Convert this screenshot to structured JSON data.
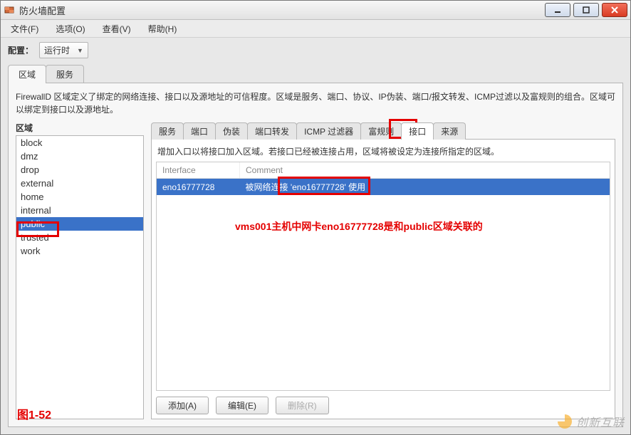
{
  "window": {
    "title": "防火墙配置"
  },
  "menubar": {
    "file": "文件(F)",
    "options": "选项(O)",
    "view": "查看(V)",
    "help": "帮助(H)"
  },
  "config": {
    "label": "配置：",
    "value": "运行时"
  },
  "outer_tabs": {
    "zones": "区域",
    "services": "服务"
  },
  "zone_desc": "FirewallD 区域定义了绑定的网络连接、接口以及源地址的可信程度。区域是服务、端口、协议、IP伪装、端口/报文转发、ICMP过滤以及富规则的组合。区域可以绑定到接口以及源地址。",
  "zone_label": "区域",
  "zones": [
    "block",
    "dmz",
    "drop",
    "external",
    "home",
    "internal",
    "public",
    "trusted",
    "work"
  ],
  "zone_selected": "public",
  "inner_tabs": {
    "services": "服务",
    "ports": "端口",
    "masquerade": "伪装",
    "port_forward": "端口转发",
    "icmp_filter": "ICMP 过滤器",
    "rich_rules": "富规则",
    "interfaces": "接口",
    "sources": "来源"
  },
  "iface_desc": "增加入口以将接口加入区域。若接口已经被连接占用，区域将被设定为连接所指定的区域。",
  "iface_table": {
    "headers": {
      "interface": "Interface",
      "comment": "Comment"
    },
    "rows": [
      {
        "interface": "eno16777728",
        "comment": "被网络连接 'eno16777728' 使用"
      }
    ]
  },
  "buttons": {
    "add": "添加(A)",
    "edit": "编辑(E)",
    "remove": "删除(R)"
  },
  "annotations": {
    "main": "vms001主机中网卡eno16777728是和public区域关联的",
    "figure": "图1-52"
  },
  "watermark": "创新互联"
}
